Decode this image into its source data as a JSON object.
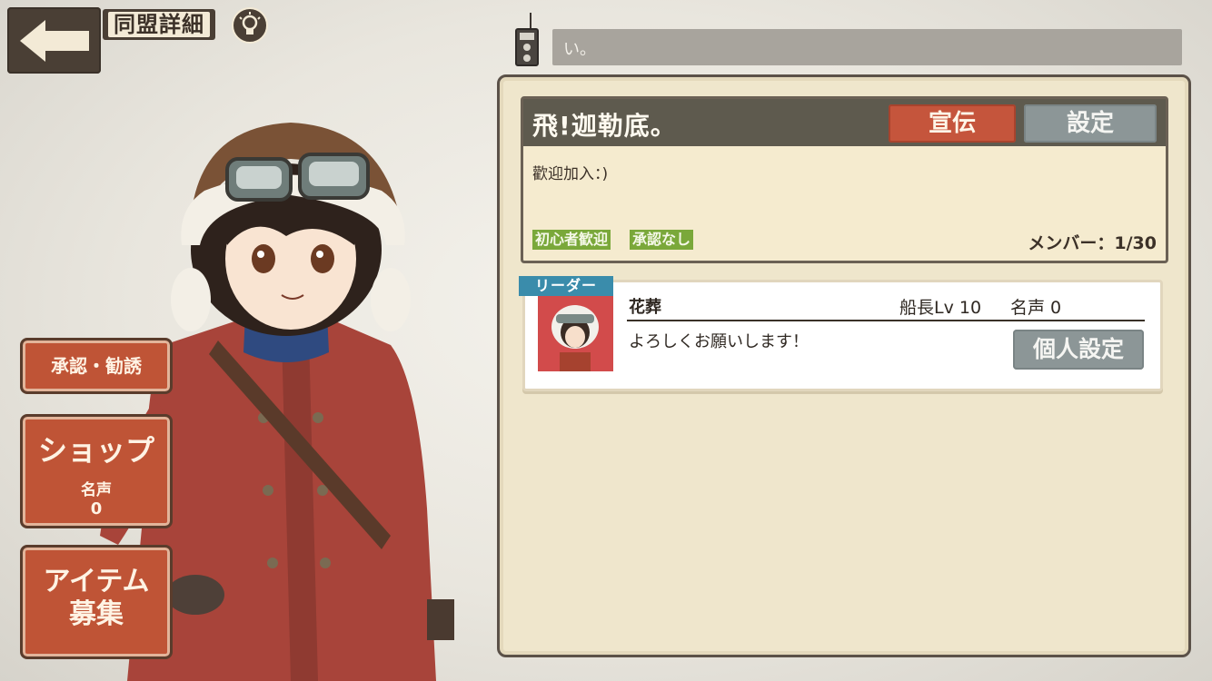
{
  "header": {
    "title": "同盟詳細"
  },
  "chat": {
    "text": "い。"
  },
  "alliance": {
    "name": "飛!迦勒底。",
    "promote_label": "宣伝",
    "settings_label": "設定",
    "description": "歡迎加入：)",
    "tags": [
      "初心者歓迎",
      "承認なし"
    ],
    "member_count": "メンバー：1/30"
  },
  "member": {
    "badge": "リーダー",
    "name": "花葬",
    "level": "船長Lv 10",
    "fame": "名声 0",
    "message": "よろしくお願いします！",
    "personal_settings_label": "個人設定"
  },
  "side_menu": {
    "approve_label": "承認・勧誘",
    "shop_label": "ショップ",
    "shop_fame_label": "名声",
    "shop_fame_value": "0",
    "item_line1": "アイテム",
    "item_line2": "募集"
  },
  "colors": {
    "accent_red": "#c5553c",
    "button_gray": "#8c9697",
    "tag_green": "#7aa83a",
    "leader_blue": "#3a8cab"
  }
}
